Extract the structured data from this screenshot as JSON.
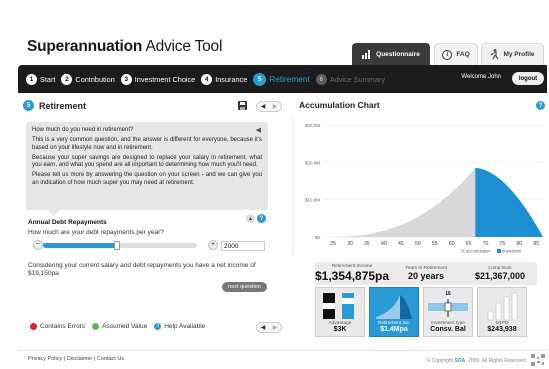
{
  "app": {
    "title_bold": "Superannuation",
    "title_rest": " Advice Tool"
  },
  "topnav": [
    {
      "label": "Questionnaire",
      "icon": "bar-chart-icon",
      "active": true
    },
    {
      "label": "FAQ",
      "icon": "info-icon",
      "active": false
    },
    {
      "label": "My Profile",
      "icon": "walking-person-icon",
      "active": false
    }
  ],
  "steps": [
    {
      "num": "1",
      "label": "Start"
    },
    {
      "num": "2",
      "label": "Contribution"
    },
    {
      "num": "3",
      "label": "Investment Choice"
    },
    {
      "num": "4",
      "label": "Insurance"
    },
    {
      "num": "5",
      "label": "Retirement"
    },
    {
      "num": "6",
      "label": "Advice Summary"
    }
  ],
  "user": {
    "welcome": "Welcome John",
    "logout": "logout"
  },
  "left": {
    "num": "5",
    "title": "Retirement",
    "intro": [
      "How much do you need in retirement?",
      "This is a very common question, and the answer is different for everyone, because it's based on your lifestyle now and in retirement.",
      "Because your super savings are designed to replace your salary in retirement, what you earn, and what you spend are all important to determining how much you'll need.",
      "Please tell us more by answering the question on your screen - and we can give you an indication of how much super you may need at retirement."
    ],
    "section": "Annual Debt Repayments",
    "question": "How much are your debt repayments per year?",
    "slider_fraction": 0.48,
    "input_value": "2000",
    "summary": "Considering your current salary and debt repayments you have a net income of $19,150pa",
    "next": "next question",
    "legend": [
      {
        "label": "Contains Errors",
        "color": "#d9232d"
      },
      {
        "label": "Assumed Value",
        "color": "#5cb85c"
      },
      {
        "label": "Help Available",
        "color": "#2a9ad6"
      }
    ]
  },
  "chart_data": {
    "type": "area",
    "title": "Accumulation Chart",
    "x": [
      25,
      30,
      35,
      40,
      45,
      50,
      55,
      60,
      65,
      70,
      75,
      80,
      85
    ],
    "yticks": [
      "$0",
      "$10.0M",
      "$20.0M",
      "$30.0M"
    ],
    "ylim": [
      0,
      30
    ],
    "accumulation_end_age": 67,
    "peak_value": 18.5,
    "series": [
      {
        "name": "accumulation",
        "color": "#d8d8d8"
      },
      {
        "name": "drawdown",
        "color": "#1e8fd0"
      }
    ]
  },
  "stats": [
    {
      "label": "Retirement Income",
      "value": "$1,354,875pa"
    },
    {
      "label": "Years in Retirement",
      "value": "20 years"
    },
    {
      "label": "Lump Sum",
      "value": "$21,367,000"
    }
  ],
  "thumbs": [
    {
      "label": "Advantage",
      "value": "$3K"
    },
    {
      "label": "Retirement Inc.",
      "value": "$1.4Mpa"
    },
    {
      "label": "Investment type",
      "value": "Consv. Bal",
      "mark": "16"
    },
    {
      "label": "DTPD",
      "value": "$243,938"
    }
  ],
  "footer": {
    "links": "Privacy Policy | Disclaimer | Contact Us",
    "copy_pre": "© Copyright ",
    "copy_brand": "SOA",
    "copy_post": ", 2009. All Rights Reserved."
  }
}
